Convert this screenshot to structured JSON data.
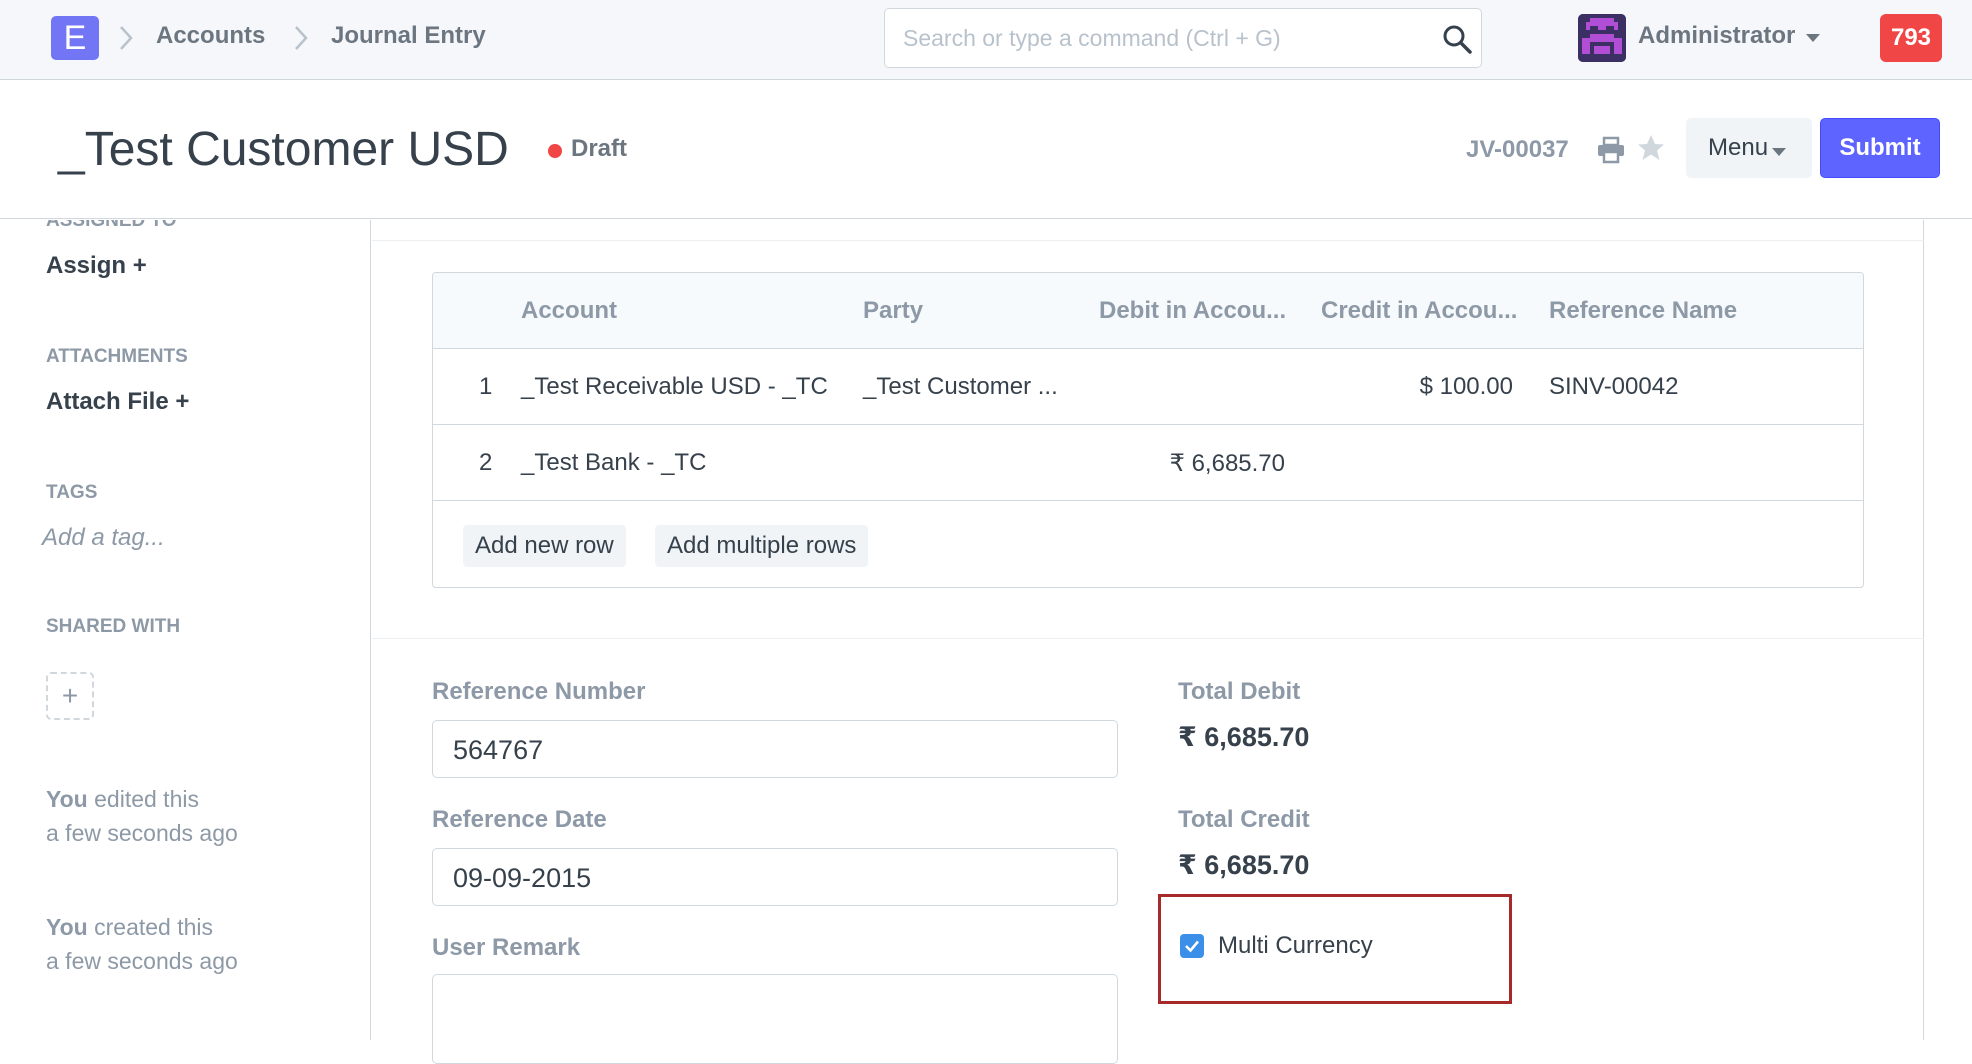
{
  "navbar": {
    "logo_letter": "E",
    "breadcrumbs": [
      "Accounts",
      "Journal Entry"
    ],
    "search_placeholder": "Search or type a command (Ctrl + G)",
    "user_name": "Administrator",
    "notification_count": "793"
  },
  "header": {
    "title": "_Test Customer USD",
    "status": "Draft",
    "doc_name": "JV-00037",
    "menu_label": "Menu",
    "submit_label": "Submit"
  },
  "sidebar": {
    "assigned_to_label": "ASSIGNED TO",
    "assign_action": "Assign",
    "attachments_label": "ATTACHMENTS",
    "attach_action": "Attach File",
    "tags_label": "TAGS",
    "tag_placeholder": "Add a tag...",
    "shared_with_label": "SHARED WITH",
    "timeline": [
      {
        "who": "You",
        "action": " edited this",
        "when": "a few seconds ago"
      },
      {
        "who": "You",
        "action": " created this",
        "when": "a few seconds ago"
      }
    ]
  },
  "accounts_table": {
    "columns": [
      "Account",
      "Party",
      "Debit in Accou...",
      "Credit in Accou...",
      "Reference Name"
    ],
    "rows": [
      {
        "idx": "1",
        "account": "_Test Receivable USD - _TC",
        "party": "_Test Customer ...",
        "debit": "",
        "credit": "$ 100.00",
        "reference_name": "SINV-00042"
      },
      {
        "idx": "2",
        "account": "_Test Bank - _TC",
        "party": "",
        "debit": "₹ 6,685.70",
        "credit": "",
        "reference_name": ""
      }
    ],
    "add_row_label": "Add new row",
    "add_multiple_label": "Add multiple rows"
  },
  "form": {
    "reference_number_label": "Reference Number",
    "reference_number_value": "564767",
    "reference_date_label": "Reference Date",
    "reference_date_value": "09-09-2015",
    "user_remark_label": "User Remark",
    "total_debit_label": "Total Debit",
    "total_debit_value": "₹ 6,685.70",
    "total_credit_label": "Total Credit",
    "total_credit_value": "₹ 6,685.70",
    "multi_currency_label": "Multi Currency",
    "multi_currency_checked": true
  },
  "colors": {
    "primary": "#5e64ff",
    "status_draft": "#f04646",
    "highlight_box": "#a72a2a",
    "checkbox": "#3b8fe8"
  }
}
